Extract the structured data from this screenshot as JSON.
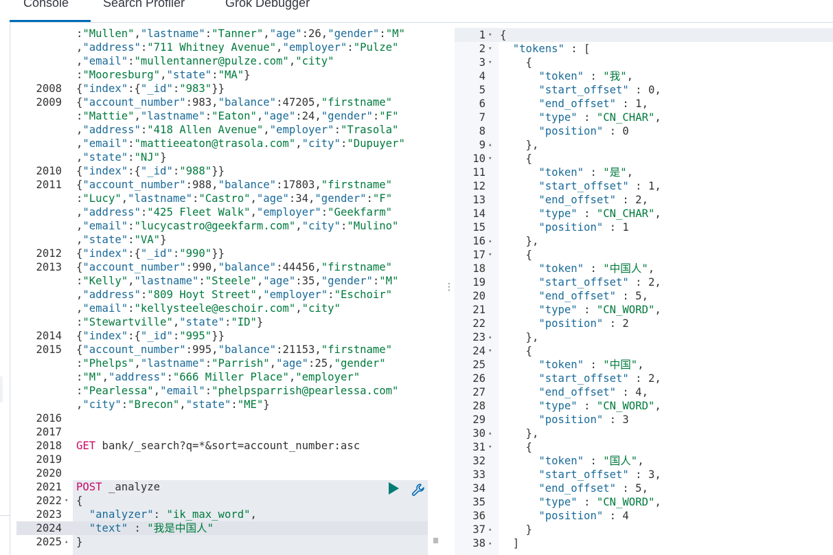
{
  "tabs": [
    {
      "label": "Console",
      "active": true
    },
    {
      "label": "Search Profiler",
      "active": false
    },
    {
      "label": "Grok Debugger",
      "active": false
    }
  ],
  "colors": {
    "accent": "#006bb4",
    "method": "#c80a68",
    "string": "#007a3d",
    "key": "#1a6a98",
    "run": "#017d73"
  },
  "icons": [
    "play-icon",
    "wrench-icon",
    "more-vertical-icon",
    "fold-arrow-icon"
  ],
  "request_editor": {
    "lines": [
      {
        "num": "",
        "text": ":\"Mullen\",\"lastname\":\"Tanner\",\"age\":26,\"gender\":\"M\""
      },
      {
        "num": "",
        "text": ",\"address\":\"711 Whitney Avenue\",\"employer\":\"Pulze\""
      },
      {
        "num": "",
        "text": ",\"email\":\"mullentanner@pulze.com\",\"city\""
      },
      {
        "num": "",
        "text": ":\"Mooresburg\",\"state\":\"MA\"}"
      },
      {
        "num": "2008",
        "text": "{\"index\":{\"_id\":\"983\"}}"
      },
      {
        "num": "2009",
        "text": "{\"account_number\":983,\"balance\":47205,\"firstname\""
      },
      {
        "num": "",
        "text": ":\"Mattie\",\"lastname\":\"Eaton\",\"age\":24,\"gender\":\"F\""
      },
      {
        "num": "",
        "text": ",\"address\":\"418 Allen Avenue\",\"employer\":\"Trasola\""
      },
      {
        "num": "",
        "text": ",\"email\":\"mattieeaton@trasola.com\",\"city\":\"Dupuyer\""
      },
      {
        "num": "",
        "text": ",\"state\":\"NJ\"}"
      },
      {
        "num": "2010",
        "text": "{\"index\":{\"_id\":\"988\"}}"
      },
      {
        "num": "2011",
        "text": "{\"account_number\":988,\"balance\":17803,\"firstname\""
      },
      {
        "num": "",
        "text": ":\"Lucy\",\"lastname\":\"Castro\",\"age\":34,\"gender\":\"F\""
      },
      {
        "num": "",
        "text": ",\"address\":\"425 Fleet Walk\",\"employer\":\"Geekfarm\""
      },
      {
        "num": "",
        "text": ",\"email\":\"lucycastro@geekfarm.com\",\"city\":\"Mulino\""
      },
      {
        "num": "",
        "text": ",\"state\":\"VA\"}"
      },
      {
        "num": "2012",
        "text": "{\"index\":{\"_id\":\"990\"}}"
      },
      {
        "num": "2013",
        "text": "{\"account_number\":990,\"balance\":44456,\"firstname\""
      },
      {
        "num": "",
        "text": ":\"Kelly\",\"lastname\":\"Steele\",\"age\":35,\"gender\":\"M\""
      },
      {
        "num": "",
        "text": ",\"address\":\"809 Hoyt Street\",\"employer\":\"Eschoir\""
      },
      {
        "num": "",
        "text": ",\"email\":\"kellysteele@eschoir.com\",\"city\""
      },
      {
        "num": "",
        "text": ":\"Stewartville\",\"state\":\"ID\"}"
      },
      {
        "num": "2014",
        "text": "{\"index\":{\"_id\":\"995\"}}"
      },
      {
        "num": "2015",
        "text": "{\"account_number\":995,\"balance\":21153,\"firstname\""
      },
      {
        "num": "",
        "text": ":\"Phelps\",\"lastname\":\"Parrish\",\"age\":25,\"gender\""
      },
      {
        "num": "",
        "text": ":\"M\",\"address\":\"666 Miller Place\",\"employer\""
      },
      {
        "num": "",
        "text": ":\"Pearlessa\",\"email\":\"phelpsparrish@pearlessa.com\""
      },
      {
        "num": "",
        "text": ",\"city\":\"Brecon\",\"state\":\"ME\"}"
      },
      {
        "num": "2016",
        "text": ""
      },
      {
        "num": "2017",
        "text": ""
      },
      {
        "num": "2018",
        "method": "GET",
        "text": " bank/_search?q=*&sort=account_number:asc"
      },
      {
        "num": "2019",
        "text": ""
      },
      {
        "num": "2020",
        "text": ""
      },
      {
        "num": "2021",
        "method": "POST",
        "text": " _analyze"
      },
      {
        "num": "2022",
        "fold": "down",
        "text": "{"
      },
      {
        "num": "2023",
        "text": "  \"analyzer\": \"ik_max_word\","
      },
      {
        "num": "2024",
        "text": "  \"text\" : \"我是中国人\""
      },
      {
        "num": "2025",
        "fold": "up",
        "text": "}"
      }
    ]
  },
  "response_editor": {
    "lines": [
      {
        "num": "1",
        "fold": "down",
        "text": "{"
      },
      {
        "num": "2",
        "fold": "down",
        "text": "  \"tokens\" : ["
      },
      {
        "num": "3",
        "fold": "down",
        "text": "    {"
      },
      {
        "num": "4",
        "text": "      \"token\" : \"我\","
      },
      {
        "num": "5",
        "text": "      \"start_offset\" : 0,"
      },
      {
        "num": "6",
        "text": "      \"end_offset\" : 1,"
      },
      {
        "num": "7",
        "text": "      \"type\" : \"CN_CHAR\","
      },
      {
        "num": "8",
        "text": "      \"position\" : 0"
      },
      {
        "num": "9",
        "fold": "up",
        "text": "    },"
      },
      {
        "num": "10",
        "fold": "down",
        "text": "    {"
      },
      {
        "num": "11",
        "text": "      \"token\" : \"是\","
      },
      {
        "num": "12",
        "text": "      \"start_offset\" : 1,"
      },
      {
        "num": "13",
        "text": "      \"end_offset\" : 2,"
      },
      {
        "num": "14",
        "text": "      \"type\" : \"CN_CHAR\","
      },
      {
        "num": "15",
        "text": "      \"position\" : 1"
      },
      {
        "num": "16",
        "fold": "up",
        "text": "    },"
      },
      {
        "num": "17",
        "fold": "down",
        "text": "    {"
      },
      {
        "num": "18",
        "text": "      \"token\" : \"中国人\","
      },
      {
        "num": "19",
        "text": "      \"start_offset\" : 2,"
      },
      {
        "num": "20",
        "text": "      \"end_offset\" : 5,"
      },
      {
        "num": "21",
        "text": "      \"type\" : \"CN_WORD\","
      },
      {
        "num": "22",
        "text": "      \"position\" : 2"
      },
      {
        "num": "23",
        "fold": "up",
        "text": "    },"
      },
      {
        "num": "24",
        "fold": "down",
        "text": "    {"
      },
      {
        "num": "25",
        "text": "      \"token\" : \"中国\","
      },
      {
        "num": "26",
        "text": "      \"start_offset\" : 2,"
      },
      {
        "num": "27",
        "text": "      \"end_offset\" : 4,"
      },
      {
        "num": "28",
        "text": "      \"type\" : \"CN_WORD\","
      },
      {
        "num": "29",
        "text": "      \"position\" : 3"
      },
      {
        "num": "30",
        "fold": "up",
        "text": "    },"
      },
      {
        "num": "31",
        "fold": "down",
        "text": "    {"
      },
      {
        "num": "32",
        "text": "      \"token\" : \"国人\","
      },
      {
        "num": "33",
        "text": "      \"start_offset\" : 3,"
      },
      {
        "num": "34",
        "text": "      \"end_offset\" : 5,"
      },
      {
        "num": "35",
        "text": "      \"type\" : \"CN_WORD\","
      },
      {
        "num": "36",
        "text": "      \"position\" : 4"
      },
      {
        "num": "37",
        "fold": "up",
        "text": "    }"
      },
      {
        "num": "38",
        "fold": "up",
        "text": "  ]"
      }
    ]
  }
}
